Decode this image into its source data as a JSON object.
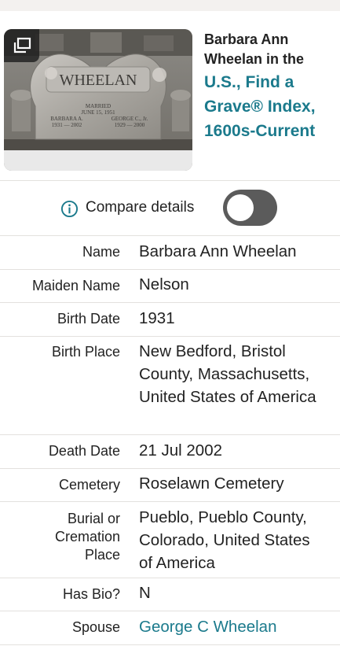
{
  "record": {
    "title_line": "Barbara Ann Wheelan in the",
    "collection_link": "U.S., Find a Grave® Index, 1600s-Current",
    "photo": {
      "headstone_inscription": {
        "surname": "WHEELAN",
        "married": "MARRIED",
        "married_date": "JUNE 15, 1951",
        "left_name": "BARBARA A.",
        "left_years": "1931 — 2002",
        "right_name": "GEORGE C., Jr.",
        "right_years": "1929 — 2000"
      }
    }
  },
  "compare": {
    "label": "Compare details",
    "enabled": false
  },
  "details": [
    {
      "label": "Name",
      "value": "Barbara Ann Wheelan",
      "link": false
    },
    {
      "label": "Maiden Name",
      "value": "Nelson",
      "link": false
    },
    {
      "label": "Birth Date",
      "value": "1931",
      "link": false
    },
    {
      "label": "Birth Place",
      "value": "New Bedford, Bristol County, Massachusetts, United States of America",
      "link": false
    },
    {
      "label": "Death Date",
      "value": "21 Jul 2002",
      "link": false
    },
    {
      "label": "Cemetery",
      "value": "Roselawn Cemetery",
      "link": false
    },
    {
      "label": "Burial or Cremation Place",
      "value": "Pueblo, Pueblo County, Colorado, United States of America",
      "link": false
    },
    {
      "label": "Has Bio?",
      "value": "N",
      "link": false
    },
    {
      "label": "Spouse",
      "value": "George C Wheelan",
      "link": true
    }
  ],
  "colors": {
    "accent": "#1b7a8c",
    "toggle_off": "#5b5b5b",
    "divider": "#e3e1de"
  }
}
